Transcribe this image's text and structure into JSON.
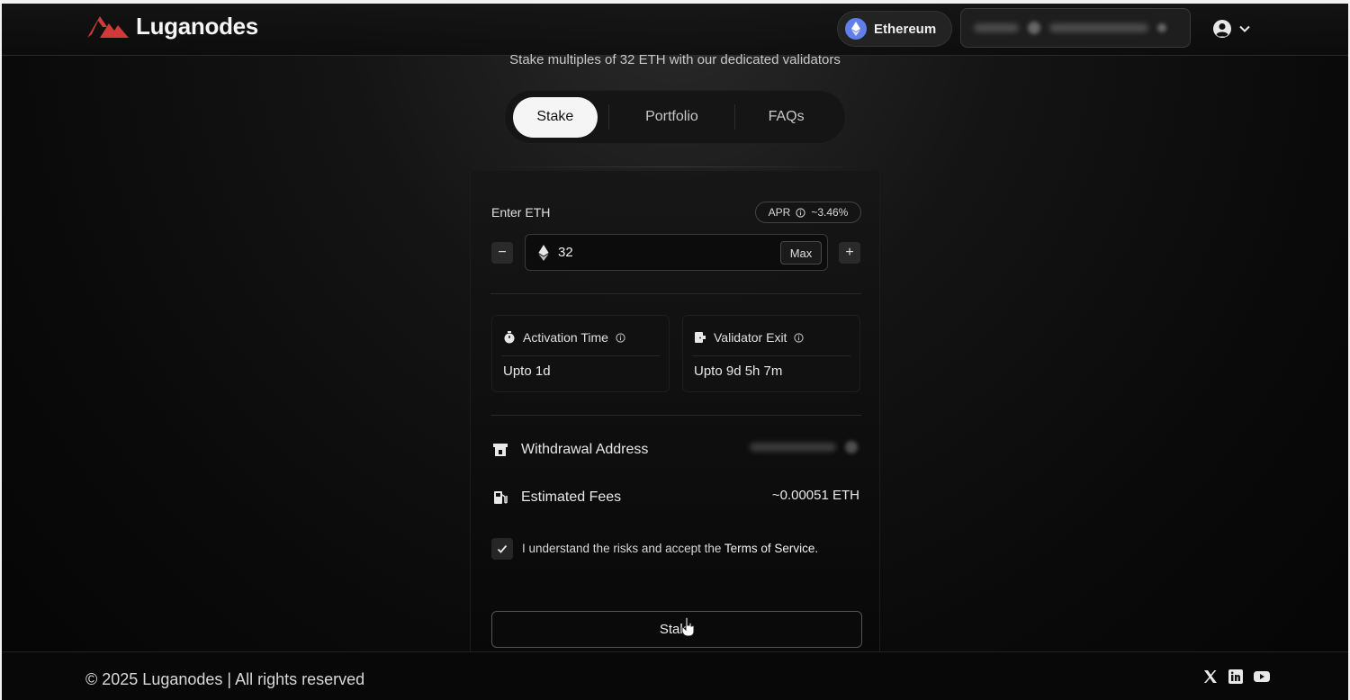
{
  "brand": {
    "name": "Luganodes",
    "accent": "#d03a3a"
  },
  "header": {
    "network": "Ethereum",
    "network_icon": "ethereum-icon",
    "account_icon": "user-circle-icon"
  },
  "hero": {
    "subtitle": "Stake multiples of 32 ETH with our dedicated validators"
  },
  "tabs": [
    {
      "label": "Stake",
      "active": true
    },
    {
      "label": "Portfolio",
      "active": false
    },
    {
      "label": "FAQs",
      "active": false
    }
  ],
  "stake_form": {
    "enter_label": "Enter ETH",
    "apr_label": "APR",
    "apr_value": "~3.46%",
    "amount": "32",
    "max_label": "Max",
    "minus_label": "−",
    "plus_label": "+",
    "activation": {
      "label": "Activation Time",
      "value": "Upto 1d"
    },
    "exit": {
      "label": "Validator Exit",
      "value": "Upto 9d 5h 7m"
    },
    "withdrawal_label": "Withdrawal Address",
    "fees_label": "Estimated Fees",
    "fees_value": "~0.00051 ETH",
    "terms_prefix": "I understand the risks and accept the",
    "terms_link": "Terms of Service.",
    "terms_checked": true,
    "submit_label": "Stake"
  },
  "footer": {
    "copyright": "© 2025 Luganodes | All rights reserved",
    "social": [
      "x-icon",
      "linkedin-icon",
      "youtube-icon"
    ]
  }
}
